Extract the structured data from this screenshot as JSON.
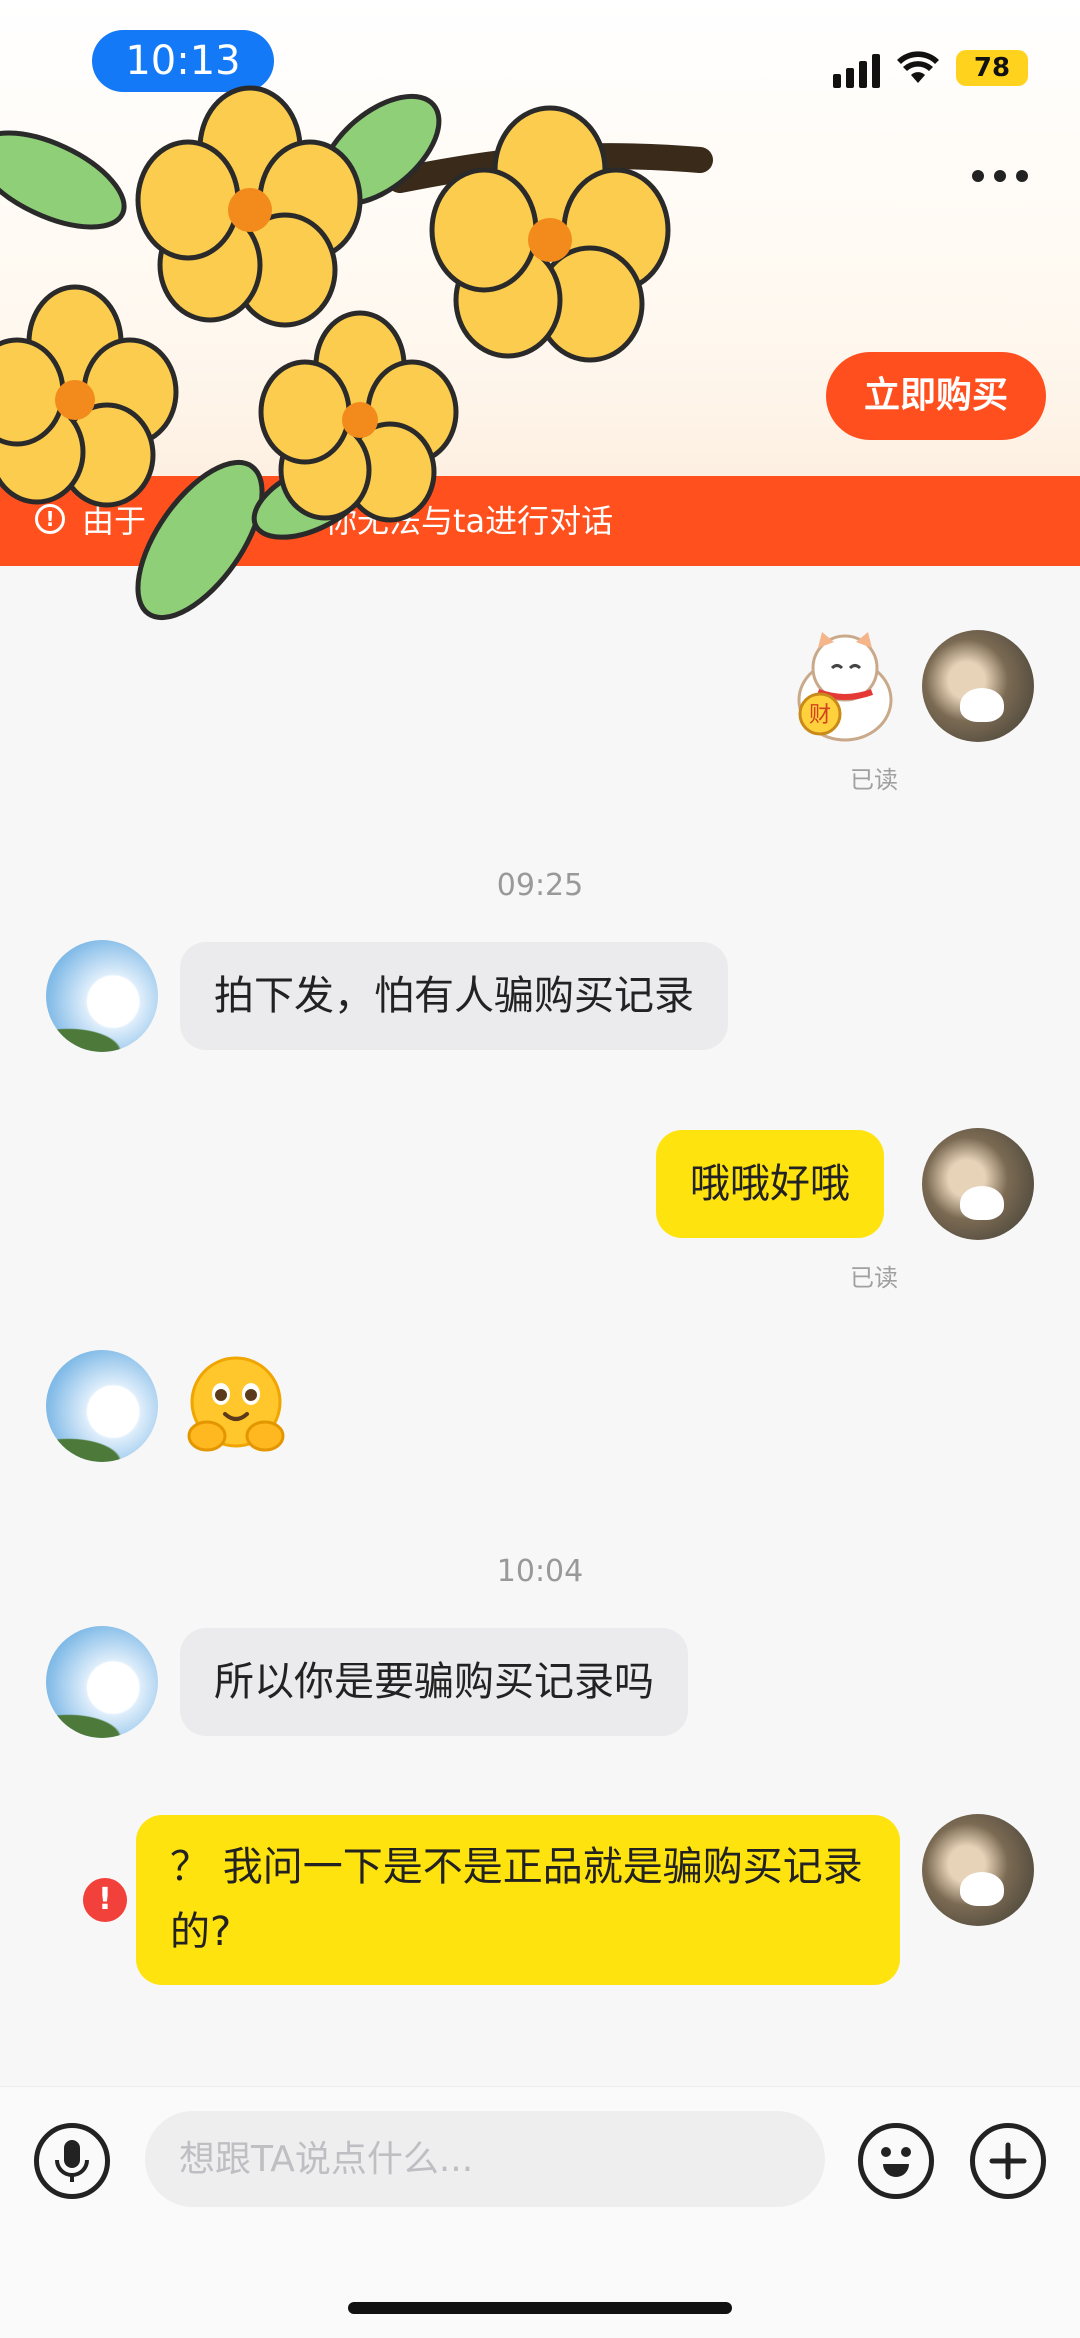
{
  "status_bar": {
    "time": "10:13",
    "battery": "78"
  },
  "header": {
    "buy_button_label": "立即购买",
    "warning_prefix": "由于",
    "warning_suffix": "你无法与ta进行对话"
  },
  "messages": [
    {
      "side": "right",
      "type": "sticker",
      "name": "lucky-cat-sticker",
      "sticker_text": "财",
      "read": "已读"
    },
    {
      "type": "timestamp",
      "text": "09:25"
    },
    {
      "side": "left",
      "type": "text",
      "text": "拍下发，怕有人骗购买记录"
    },
    {
      "side": "right",
      "type": "text",
      "text": "哦哦好哦",
      "read": "已读"
    },
    {
      "side": "left",
      "type": "emoji",
      "name": "hug-emoji"
    },
    {
      "type": "timestamp",
      "text": "10:04"
    },
    {
      "side": "left",
      "type": "text",
      "text": "所以你是要骗购买记录吗"
    },
    {
      "side": "right",
      "type": "text",
      "text": "？ 我问一下是不是正品就是骗购买记录的?",
      "failed": true
    }
  ],
  "input": {
    "placeholder": "想跟TA说点什么..."
  },
  "colors": {
    "accent": "#ff501d",
    "bubble_self": "#ffe30f",
    "bubble_other": "#ebebed",
    "time_pill": "#1479f6"
  },
  "icons": [
    "mic-icon",
    "emoji-icon",
    "plus-icon",
    "more-icon",
    "wifi-icon",
    "signal-icon",
    "battery-icon"
  ]
}
